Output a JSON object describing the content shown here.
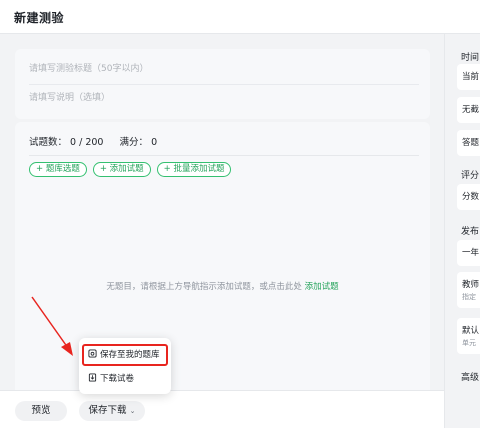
{
  "header": {
    "title": "新建测验"
  },
  "basic_info": {
    "title_placeholder": "请填写测验标题（50字以内）",
    "desc_placeholder": "请填写说明（选填）"
  },
  "questions": {
    "count_label": "试题数：",
    "count_value": "0 / 200",
    "score_label": "满分：",
    "score_value": "0",
    "chips": [
      "+ 题库选题",
      "+ 添加试题",
      "+ 批量添加试题"
    ],
    "empty_text": "无题目，请根据上方导航指示添加试题，或点击此处",
    "empty_link": "添加试题"
  },
  "footer": {
    "preview_label": "预览",
    "save_label": "保存下载",
    "save_caret": "⌄"
  },
  "dropdown": {
    "items": [
      {
        "label": "保存至我的题库",
        "icon": "save-icon",
        "selected": true
      },
      {
        "label": "下载试卷",
        "icon": "download-icon",
        "selected": false
      }
    ]
  },
  "sidebar": {
    "time_label": "时间",
    "time_opt1": "当前",
    "time_opt2": "无截",
    "time_opt3": "答题",
    "score_label": "评分",
    "score_opt1": "分数",
    "publish_label": "发布",
    "publish_opt1": "一年",
    "publish_opt2": "教师",
    "publish_opt2_sub": "指定",
    "publish_opt3": "默认",
    "publish_opt3_sub": "单元",
    "advanced_label": "高级"
  },
  "colors": {
    "accent_green": "#26a45c",
    "highlight_red": "#e8251f"
  }
}
